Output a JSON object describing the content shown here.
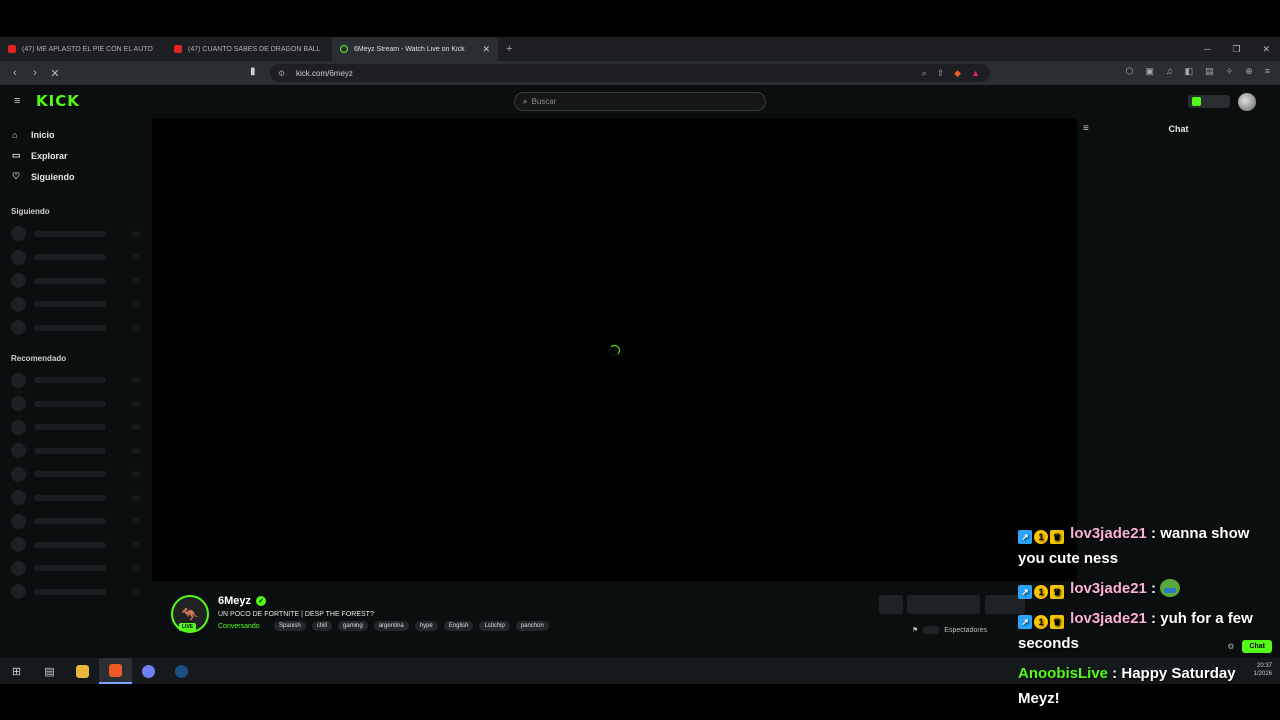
{
  "tabs": [
    {
      "label": "(47) ME APLASTÓ EL PIE CON EL AUTO",
      "favicon": "youtube-icon",
      "active": false
    },
    {
      "label": "(47) CUANTO SABES DE DRAGON BALL",
      "favicon": "youtube-icon",
      "active": false
    },
    {
      "label": "6Meyz Stream - Watch Live on Kick",
      "favicon": "kick-icon",
      "active": true
    }
  ],
  "new_tab": "+",
  "address": {
    "url": "kick.com/6meyz"
  },
  "kick": {
    "logo": "KICK",
    "search_placeholder": "Buscar",
    "nav": [
      {
        "label": "Inicio",
        "icon": "home-icon"
      },
      {
        "label": "Explorar",
        "icon": "compass-icon"
      },
      {
        "label": "Siguiendo",
        "icon": "heart-icon"
      }
    ],
    "section_following": "Siguiendo",
    "section_recommended": "Recomendado",
    "chat_title": "Chat",
    "chat_send": "Chat"
  },
  "channel": {
    "name": "6Meyz",
    "live_badge": "LIVE",
    "title": "UN POCO DE FORTNITE | DESP THE FOREST?",
    "category": "Conversando",
    "tags": [
      "Spanish",
      "chill",
      "gaming",
      "argentina",
      "hype",
      "English",
      "Lstichip",
      "panchon"
    ],
    "viewers_label": "Espectadores"
  },
  "overlay_chat": [
    {
      "user": "lov3jade21",
      "text": "wanna show you cute ness",
      "color": "pink",
      "badges": true
    },
    {
      "user": "lov3jade21",
      "text": "",
      "color": "pink",
      "badges": true,
      "emote": "pepe-emote"
    },
    {
      "user": "lov3jade21",
      "text": "yuh for a few seconds",
      "color": "pink",
      "badges": true
    },
    {
      "user": "AnoobisLive",
      "text": "Happy Saturday Meyz!",
      "color": "green",
      "badges": false
    }
  ],
  "clock": {
    "time": "20:37",
    "date": "1/2026"
  },
  "colors": {
    "accent": "#53fc18",
    "background": "#0b0e0f"
  }
}
